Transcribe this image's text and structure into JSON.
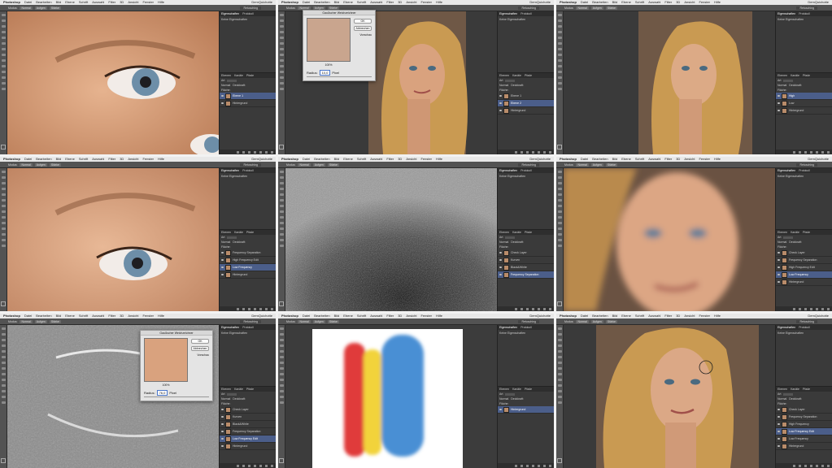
{
  "app": {
    "name": "Photoshop",
    "menu": [
      "Datei",
      "Bearbeiten",
      "Bild",
      "Ebene",
      "Schrift",
      "Auswahl",
      "Filter",
      "3D",
      "Ansicht",
      "Fenster",
      "Hilfe"
    ],
    "clock": "DemQuichotte",
    "workspace": "Retusching"
  },
  "options": {
    "modus_label": "Modus:",
    "modus_value": "Normal",
    "items": [
      "Aufgen",
      "Stärke"
    ]
  },
  "panels": {
    "tabs": [
      "Eigenschaften",
      "Protokoll"
    ],
    "props_title": "Keine Eigenschaften",
    "layer_tabs": [
      "Ebenen",
      "Kanäle",
      "Pfade"
    ],
    "filter_label": "Art",
    "blend": "Normal",
    "opacity": "Deckkraft:",
    "fill": "Fläche:"
  },
  "dialog": {
    "title": "Gaußscher Weichzeichner",
    "ok": "OK",
    "cancel": "Abbrechen",
    "preview": "Vorschau",
    "zoom": "100%",
    "radius_label": "Radius:",
    "unit": "Pixel"
  },
  "frames": [
    {
      "name": "frame-1",
      "layers": [
        {
          "label": "Ebene 1"
        },
        {
          "label": "Hintergrund"
        }
      ],
      "selected": 0
    },
    {
      "name": "frame-2",
      "layers": [
        {
          "label": "Ebene 1"
        },
        {
          "label": "Ebene 2"
        },
        {
          "label": "Hintergrund"
        }
      ],
      "selected": 1,
      "radius": "10,0"
    },
    {
      "name": "frame-3",
      "layers": [
        {
          "label": "High"
        },
        {
          "label": "Low"
        },
        {
          "label": "Hintergrund"
        }
      ],
      "selected": 0
    },
    {
      "name": "frame-4",
      "layers": [
        {
          "label": "Frequency Separation"
        },
        {
          "label": "High Frequency Edit"
        },
        {
          "label": "Low Frequency"
        },
        {
          "label": "Hintergrund"
        }
      ],
      "selected": 2
    },
    {
      "name": "frame-5",
      "layers": [
        {
          "label": "Check Layer"
        },
        {
          "label": "Kurven"
        },
        {
          "label": "Black&White"
        },
        {
          "label": "Frequency Separation"
        }
      ],
      "selected": 3
    },
    {
      "name": "frame-6",
      "layers": [
        {
          "label": "Check Layer"
        },
        {
          "label": "Frequency Separation"
        },
        {
          "label": "High Frequency Edit"
        },
        {
          "label": "Low Frequency"
        },
        {
          "label": "Hintergrund"
        }
      ],
      "selected": 3
    },
    {
      "name": "frame-7",
      "layers": [
        {
          "label": "Check Layer"
        },
        {
          "label": "Kurven"
        },
        {
          "label": "Black&White"
        },
        {
          "label": "Frequency Separation"
        },
        {
          "label": "Low Frequency Edit"
        },
        {
          "label": "Hintergrund"
        }
      ],
      "selected": 4,
      "radius": "76,0"
    },
    {
      "name": "frame-8",
      "layers": [
        {
          "label": "Hintergrund"
        }
      ],
      "selected": 0
    },
    {
      "name": "frame-9",
      "layers": [
        {
          "label": "Check Layer"
        },
        {
          "label": "Frequency Separation"
        },
        {
          "label": "High Frequency"
        },
        {
          "label": "Low Frequency Edit"
        },
        {
          "label": "Low Frequency"
        },
        {
          "label": "Hintergrund"
        }
      ],
      "selected": 3
    }
  ],
  "colors": {
    "ui_dark": "#3c3c3c",
    "panel": "#3a3a3a",
    "selection": "#4b5e8a",
    "skin": "#d9a27e",
    "hair": "#c99a52",
    "brush_red": "#e03a3a",
    "brush_yellow": "#f2d33a",
    "brush_blue": "#4a8fd4"
  }
}
